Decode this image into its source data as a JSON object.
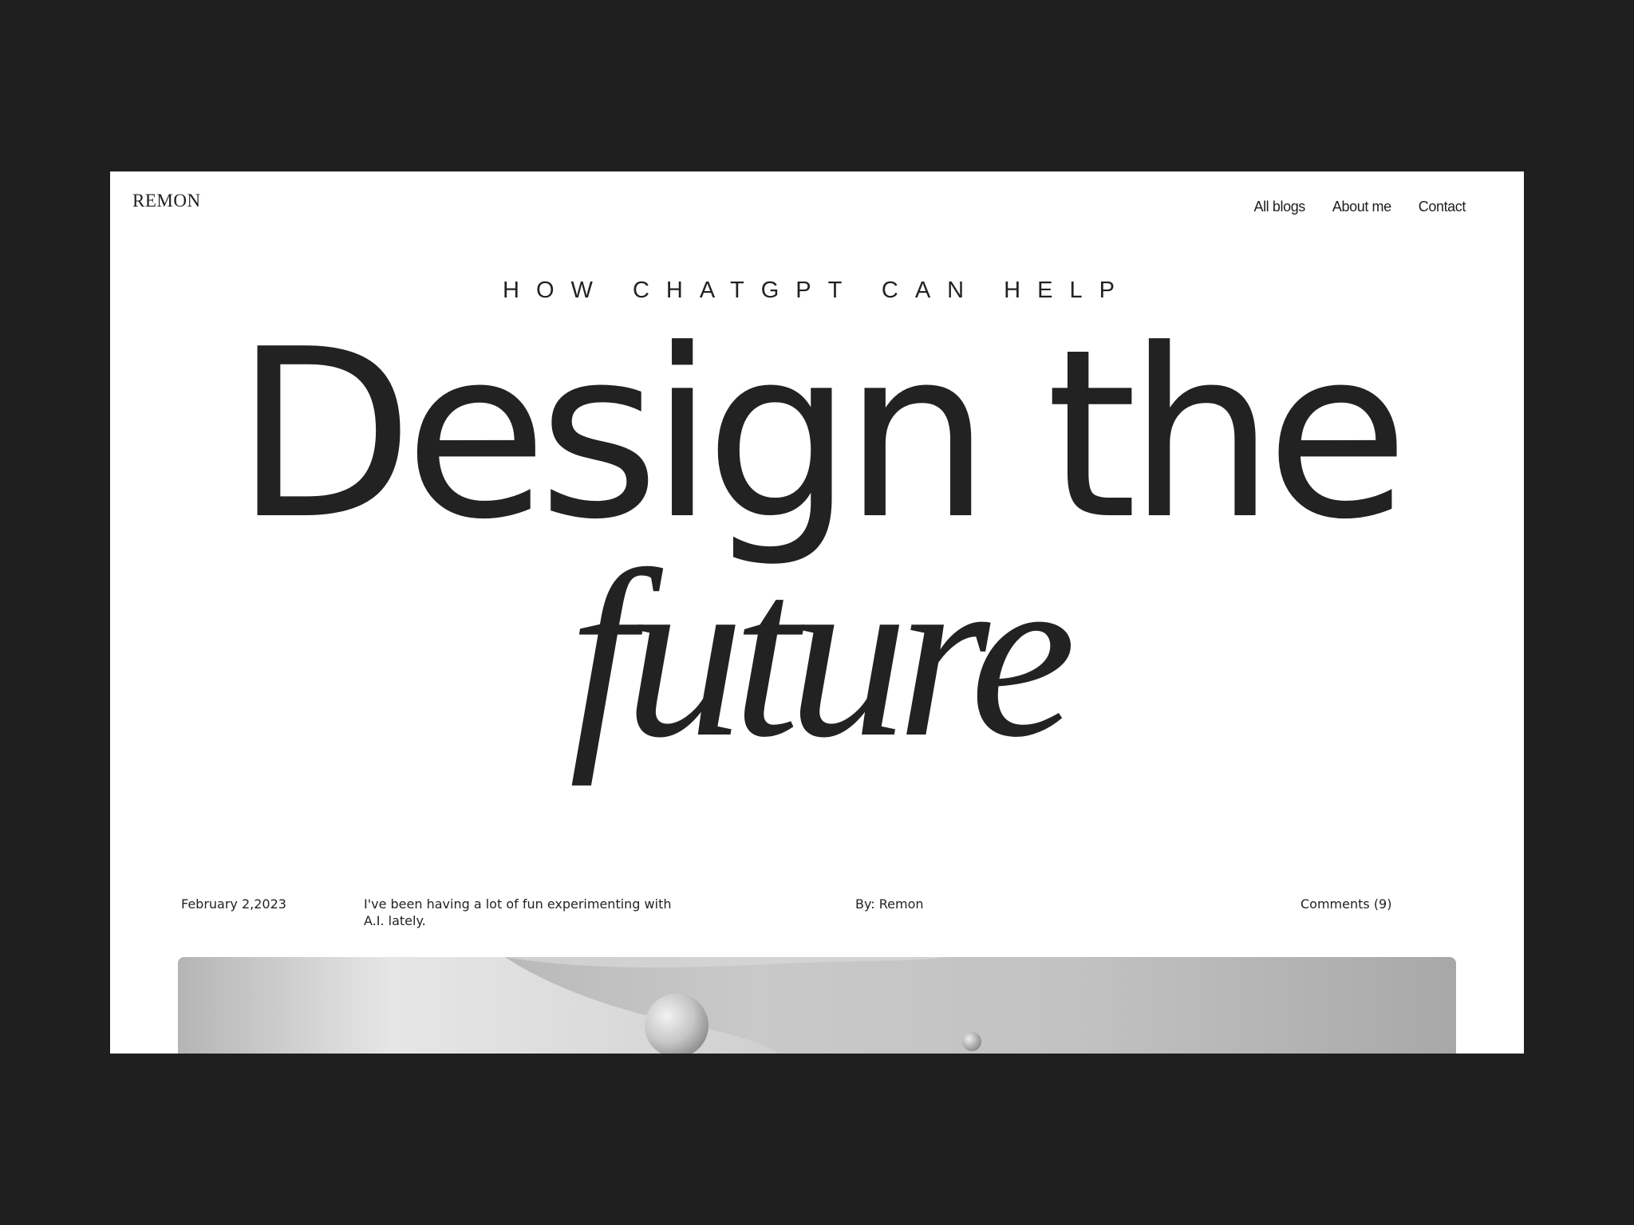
{
  "site": {
    "logo": "REMON"
  },
  "nav": {
    "items": [
      {
        "label": "All blogs"
      },
      {
        "label": "About me"
      },
      {
        "label": "Contact"
      }
    ]
  },
  "hero": {
    "kicker": "HOW CHATGPT CAN HELP",
    "title_line1": "Design the",
    "title_line2": "future"
  },
  "post_meta": {
    "date": "February 2,2023",
    "excerpt": "I've been having a lot of fun experimenting with A.I. lately.",
    "author": "By: Remon",
    "comments": "Comments (9)"
  }
}
